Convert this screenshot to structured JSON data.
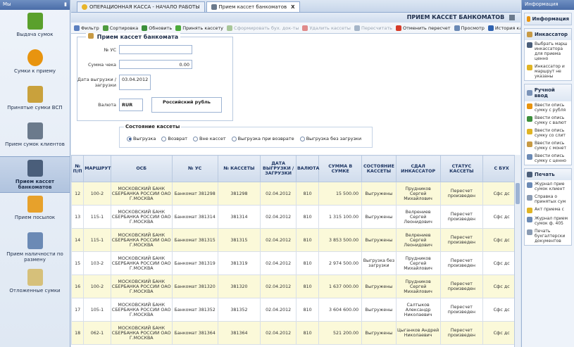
{
  "left_panel": {
    "header": "Мы",
    "items": [
      {
        "label": "Выдача сумок",
        "icon": "bag-out-icon",
        "color": "#5aa02c"
      },
      {
        "label": "Сумки к приему",
        "icon": "info-icon",
        "color": "#e8940f"
      },
      {
        "label": "Принятые сумки ВСП",
        "icon": "pillars-icon",
        "color": "#c9a13c"
      },
      {
        "label": "Прием сумок клиентов",
        "icon": "column-icon",
        "color": "#6b7a8c"
      },
      {
        "label": "Прием кассет банкоматов",
        "icon": "cassette-icon",
        "color": "#4a5e7a"
      },
      {
        "label": "Прием посылок",
        "icon": "parcel-icon",
        "color": "#e7a12b"
      },
      {
        "label": "Прием наличности по размену",
        "icon": "cash-exchange-icon",
        "color": "#6b8ab5"
      },
      {
        "label": "Отложенные сумки",
        "icon": "refresh-icon",
        "color": "#d6c07a"
      }
    ]
  },
  "tabs": [
    {
      "label": "ОПЕРАЦИОННАЯ КАССА - НАЧАЛО РАБОТЫ"
    },
    {
      "label": "Прием кассет банкоматов",
      "close": "X"
    }
  ],
  "title": "ПРИЕМ КАССЕТ БАНКОМАТОВ",
  "toolbar": [
    {
      "label": "Фильтр",
      "enabled": true,
      "color": "#5b7fbf"
    },
    {
      "label": "Сортировка",
      "enabled": true,
      "color": "#4f9b3f"
    },
    {
      "label": "Обновить",
      "enabled": true,
      "color": "#3b8f3b"
    },
    {
      "label": "Принять кассету",
      "enabled": true,
      "color": "#4caa3a"
    },
    {
      "label": "Сформировать бух. док-ты",
      "enabled": false,
      "color": "#a8c79a"
    },
    {
      "label": "Удалить кассеты",
      "enabled": false,
      "color": "#e08a8a"
    },
    {
      "label": "Пересчитать",
      "enabled": false,
      "color": "#a5b5c8"
    },
    {
      "label": "Отменить пересчет",
      "enabled": true,
      "color": "#d63c2a"
    },
    {
      "label": "Просмотр",
      "enabled": true,
      "color": "#6b8ab5"
    },
    {
      "label": "История кассеты",
      "enabled": true,
      "color": "#2f62b0"
    }
  ],
  "form": {
    "group_title": "Прием кассет банкомата",
    "uc_label": "№ УС",
    "uc_value": "",
    "sum_label": "Сумма чека",
    "sum_value": "0.00",
    "date_label": "Дата выгрузки / загрузки",
    "date_value": "03.04.2012",
    "currency_label": "Валюта",
    "currency_code": "RUR",
    "currency_name": "Российский рубль",
    "state_title": "Состояние кассеты",
    "state_options": [
      "Выгрузка",
      "Возврат",
      "Вне кассет",
      "Выгрузка при возврате",
      "Выгрузка без загрузки"
    ],
    "state_selected": "Выгрузка"
  },
  "table": {
    "headers": [
      "№ П/П",
      "МАРШРУТ",
      "ОСБ",
      "№ УС",
      "№ КАССЕТЫ",
      "ДАТА ВЫГРУЗКИ / ЗАГРУЗКИ",
      "ВАЛЮТА",
      "СУММА В СУМКЕ",
      "СОСТОЯНИЕ КАССЕТЫ",
      "СДАЛ ИНКАССАТОР",
      "СТАТУС КАССЕТЫ",
      "С БУХ"
    ],
    "rows": [
      [
        "12",
        "100-2",
        "МОСКОВСКИЙ БАНК СБЕРБАНКА РОССИИ ОАО Г.МОСКВА",
        "Банкомат 381298",
        "381298",
        "02.04.2012",
        "810",
        "15 500.00",
        "Выгружены",
        "Прудников Сергей Михайлович",
        "Пересчет произведен",
        "Сфс дс"
      ],
      [
        "13",
        "115-1",
        "МОСКОВСКИЙ БАНК СБЕРБАНКА РОССИИ ОАО Г.МОСКВА",
        "Банкомат 381314",
        "381314",
        "02.04.2012",
        "810",
        "1 315 100.00",
        "Выгружены",
        "Велрениев Сергей Леонидович",
        "Пересчет произведен",
        "Сфс дс"
      ],
      [
        "14",
        "115-1",
        "МОСКОВСКИЙ БАНК СБЕРБАНКА РОССИИ ОАО Г.МОСКВА",
        "Банкомат 381315",
        "381315",
        "02.04.2012",
        "810",
        "3 853 500.00",
        "Выгружены",
        "Велрениев Сергей Леонидович",
        "Пересчет произведен",
        "Сфс дс"
      ],
      [
        "15",
        "103-2",
        "МОСКОВСКИЙ БАНК СБЕРБАНКА РОССИИ ОАО Г.МОСКВА",
        "Банкомат 381319",
        "381319",
        "02.04.2012",
        "810",
        "2 974 500.00",
        "Выгрузка без загрузки",
        "Прудников Сергей Михайлович",
        "Пересчет произведен",
        "Сфс дс"
      ],
      [
        "16",
        "100-2",
        "МОСКОВСКИЙ БАНК СБЕРБАНКА РОССИИ ОАО Г.МОСКВА",
        "Банкомат 381320",
        "381320",
        "02.04.2012",
        "810",
        "1 637 000.00",
        "Выгружены",
        "Прудников Сергей Михайлович",
        "Пересчет произведен",
        "Сфс дс"
      ],
      [
        "17",
        "105-1",
        "МОСКОВСКИЙ БАНК СБЕРБАНКА РОССИИ ОАО Г.МОСКВА",
        "Банкомат 381352",
        "381352",
        "02.04.2012",
        "810",
        "3 604 600.00",
        "Выгружены",
        "Салтыков Александр Николаевич",
        "Пересчет произведен",
        "Сфс дс"
      ],
      [
        "18",
        "062-1",
        "МОСКОВСКИЙ БАНК СБЕРБАНКА РОССИИ ОАО Г.МОСКВА",
        "Банкомат 381364",
        "381364",
        "02.04.2012",
        "810",
        "521 200.00",
        "Выгружены",
        "Цыганков Андрей Николаевич",
        "Пересчет произведен",
        "Сфс дс"
      ]
    ]
  },
  "right_panel": {
    "header": "Информация",
    "sections": [
      {
        "title": "Информация",
        "icon": "info-icon",
        "color": "#e8940f",
        "items": []
      },
      {
        "title": "Инкассатор",
        "icon": "document-icon",
        "color": "#c79a45",
        "items": [
          {
            "text": "Выбрать марш инкассатора для приема ценно",
            "icon": "people-icon",
            "color": "#4a5e7a"
          },
          {
            "text": "Инкассатор и маршрут не указаны",
            "icon": "warning-icon",
            "color": "#e0b424"
          }
        ]
      },
      {
        "title": "Ручной ввод",
        "icon": "form-icon",
        "color": "#7a93b8",
        "items": [
          {
            "text": "Ввести опись сумку с рубля",
            "icon": "coin-icon",
            "color": "#e8940f"
          },
          {
            "text": "Ввести опись сумку с валют",
            "icon": "dollar-icon",
            "color": "#3b8f3b"
          },
          {
            "text": "Ввести опись сумку со слит",
            "icon": "gold-icon",
            "color": "#e0b424"
          },
          {
            "text": "Ввести опись сумку с монет",
            "icon": "coins-icon",
            "color": "#c79a45"
          },
          {
            "text": "Ввести опись сумку с ценно",
            "icon": "box-icon",
            "color": "#6b8ab5"
          }
        ]
      },
      {
        "title": "Печать",
        "icon": "print-icon",
        "color": "#4a5e7a",
        "items": [
          {
            "text": "Журнал прие сумок клиент",
            "icon": "journal-icon",
            "color": "#6b8ab5"
          },
          {
            "text": "Справка о принятых сум",
            "icon": "doc-icon",
            "color": "#8a9bb3"
          },
          {
            "text": "Акт приема с",
            "icon": "pencil-icon",
            "color": "#e0b424"
          },
          {
            "text": "Журнал прием сумок ф. 405",
            "icon": "journal-icon",
            "color": "#6b8ab5"
          },
          {
            "text": "Печать бухгалтерски документов",
            "icon": "doc-icon",
            "color": "#8a9bb3"
          }
        ]
      }
    ]
  }
}
